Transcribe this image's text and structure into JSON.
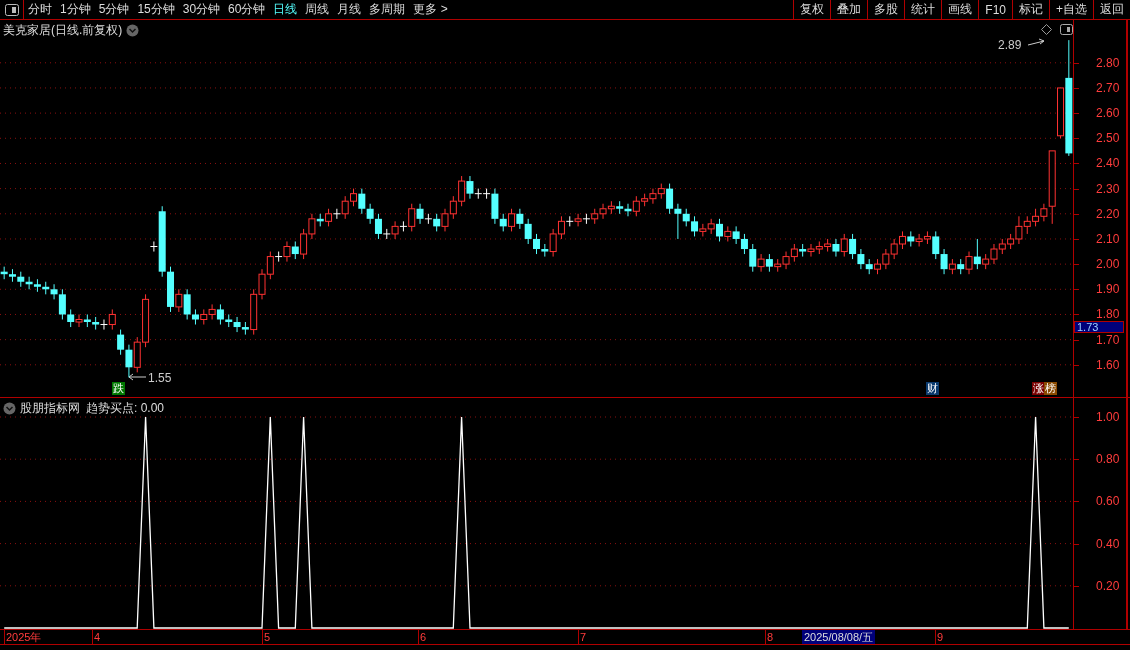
{
  "toolbar": {
    "periods": [
      {
        "label": "分时",
        "selected": false
      },
      {
        "label": "1分钟",
        "selected": false
      },
      {
        "label": "5分钟",
        "selected": false
      },
      {
        "label": "15分钟",
        "selected": false
      },
      {
        "label": "30分钟",
        "selected": false
      },
      {
        "label": "60分钟",
        "selected": false
      },
      {
        "label": "日线",
        "selected": true
      },
      {
        "label": "周线",
        "selected": false
      },
      {
        "label": "月线",
        "selected": false
      },
      {
        "label": "多周期",
        "selected": false
      },
      {
        "label": "更多 >",
        "selected": false
      }
    ],
    "buttons": [
      "复权",
      "叠加",
      "多股",
      "统计",
      "画线",
      "F10",
      "标记",
      "+自选",
      "返回"
    ]
  },
  "main_chart": {
    "title": "美克家居(日线.前复权)",
    "high_label": "2.89",
    "low_label": "1.55",
    "current_price": "1.73",
    "markers": [
      {
        "text": "跌",
        "color": "#007800"
      },
      {
        "text": "财",
        "color": "#0a3a6e"
      },
      {
        "text": "涨",
        "color": "#7a0000"
      },
      {
        "text": "榜",
        "color": "#8a4a00"
      }
    ],
    "chart_data": {
      "type": "candlestick",
      "grid": true,
      "ylim": [
        1.48,
        2.97
      ],
      "categories": [
        null,
        null,
        null,
        null,
        null,
        null,
        null,
        null,
        null,
        null,
        null,
        null,
        null,
        null,
        null,
        null,
        null,
        null,
        null,
        null,
        null,
        null,
        null,
        null,
        null,
        null,
        null,
        null,
        null,
        null,
        null,
        null,
        null,
        null,
        null,
        null,
        null,
        null,
        null,
        null,
        null,
        null,
        null,
        null,
        null,
        null,
        null,
        null,
        null,
        null,
        null,
        null,
        null,
        null,
        null,
        null,
        null,
        null,
        null,
        null,
        null,
        null,
        null,
        null,
        null,
        null,
        null,
        null,
        null,
        null,
        null,
        null,
        null,
        null,
        null,
        null,
        null,
        null,
        null,
        null,
        null,
        null,
        null,
        null,
        null,
        null,
        null,
        null,
        null,
        null,
        null,
        null,
        null,
        null,
        null,
        null,
        null,
        null,
        null,
        null,
        null,
        null,
        null,
        null,
        null,
        null,
        null,
        null,
        null,
        null,
        null,
        null,
        null,
        null,
        null,
        null,
        null,
        null,
        null,
        null,
        null,
        null,
        null,
        null,
        null,
        null,
        null,
        null,
        null
      ],
      "yticks": [
        {
          "value": 2.8,
          "label": "2.80"
        },
        {
          "value": 2.7,
          "label": "2.70"
        },
        {
          "value": 2.6,
          "label": "2.60"
        },
        {
          "value": 2.5,
          "label": "2.50"
        },
        {
          "value": 2.4,
          "label": "2.40"
        },
        {
          "value": 2.3,
          "label": "2.30"
        },
        {
          "value": 2.2,
          "label": "2.20"
        },
        {
          "value": 2.1,
          "label": "2.10"
        },
        {
          "value": 2.0,
          "label": "2.00"
        },
        {
          "value": 1.9,
          "label": "1.90"
        },
        {
          "value": 1.8,
          "label": "1.80"
        },
        {
          "value": 1.7,
          "label": "1.70"
        },
        {
          "value": 1.6,
          "label": "1.60"
        }
      ],
      "ohlc": [
        [
          1.97,
          1.99,
          1.94,
          1.96
        ],
        [
          1.96,
          1.98,
          1.93,
          1.95
        ],
        [
          1.95,
          1.97,
          1.91,
          1.93
        ],
        [
          1.93,
          1.95,
          1.9,
          1.92
        ],
        [
          1.92,
          1.94,
          1.89,
          1.91
        ],
        [
          1.91,
          1.93,
          1.88,
          1.9
        ],
        [
          1.9,
          1.92,
          1.86,
          1.88
        ],
        [
          1.88,
          1.9,
          1.78,
          1.8
        ],
        [
          1.8,
          1.82,
          1.75,
          1.77
        ],
        [
          1.77,
          1.8,
          1.75,
          1.78
        ],
        [
          1.78,
          1.8,
          1.75,
          1.77
        ],
        [
          1.77,
          1.79,
          1.74,
          1.76
        ],
        [
          1.76,
          1.78,
          1.74,
          1.76
        ],
        [
          1.76,
          1.82,
          1.74,
          1.8
        ],
        [
          1.72,
          1.74,
          1.64,
          1.66
        ],
        [
          1.66,
          1.68,
          1.55,
          1.59
        ],
        [
          1.59,
          1.71,
          1.57,
          1.69
        ],
        [
          1.69,
          1.88,
          1.67,
          1.86
        ],
        [
          2.07,
          2.09,
          2.05,
          2.07
        ],
        [
          2.21,
          2.23,
          1.95,
          1.97
        ],
        [
          1.97,
          1.99,
          1.81,
          1.83
        ],
        [
          1.83,
          1.9,
          1.81,
          1.88
        ],
        [
          1.88,
          1.9,
          1.78,
          1.8
        ],
        [
          1.8,
          1.82,
          1.76,
          1.78
        ],
        [
          1.78,
          1.82,
          1.76,
          1.8
        ],
        [
          1.8,
          1.84,
          1.78,
          1.82
        ],
        [
          1.82,
          1.84,
          1.76,
          1.78
        ],
        [
          1.78,
          1.8,
          1.75,
          1.77
        ],
        [
          1.77,
          1.79,
          1.73,
          1.75
        ],
        [
          1.75,
          1.77,
          1.72,
          1.74
        ],
        [
          1.74,
          1.9,
          1.72,
          1.88
        ],
        [
          1.88,
          1.98,
          1.86,
          1.96
        ],
        [
          1.96,
          2.05,
          1.94,
          2.03
        ],
        [
          2.03,
          2.05,
          2.01,
          2.03
        ],
        [
          2.03,
          2.09,
          2.01,
          2.07
        ],
        [
          2.07,
          2.09,
          2.02,
          2.04
        ],
        [
          2.04,
          2.14,
          2.02,
          2.12
        ],
        [
          2.12,
          2.2,
          2.1,
          2.18
        ],
        [
          2.18,
          2.2,
          2.15,
          2.17
        ],
        [
          2.17,
          2.22,
          2.15,
          2.2
        ],
        [
          2.2,
          2.22,
          2.18,
          2.2
        ],
        [
          2.2,
          2.27,
          2.18,
          2.25
        ],
        [
          2.25,
          2.3,
          2.23,
          2.28
        ],
        [
          2.28,
          2.3,
          2.2,
          2.22
        ],
        [
          2.22,
          2.24,
          2.16,
          2.18
        ],
        [
          2.18,
          2.2,
          2.1,
          2.12
        ],
        [
          2.12,
          2.14,
          2.1,
          2.12
        ],
        [
          2.12,
          2.17,
          2.1,
          2.15
        ],
        [
          2.15,
          2.17,
          2.13,
          2.15
        ],
        [
          2.15,
          2.24,
          2.13,
          2.22
        ],
        [
          2.22,
          2.24,
          2.16,
          2.18
        ],
        [
          2.18,
          2.2,
          2.16,
          2.18
        ],
        [
          2.18,
          2.2,
          2.13,
          2.15
        ],
        [
          2.15,
          2.22,
          2.13,
          2.2
        ],
        [
          2.2,
          2.27,
          2.18,
          2.25
        ],
        [
          2.25,
          2.35,
          2.23,
          2.33
        ],
        [
          2.33,
          2.35,
          2.26,
          2.28
        ],
        [
          2.28,
          2.3,
          2.26,
          2.28
        ],
        [
          2.28,
          2.3,
          2.26,
          2.28
        ],
        [
          2.28,
          2.3,
          2.16,
          2.18
        ],
        [
          2.18,
          2.2,
          2.13,
          2.15
        ],
        [
          2.15,
          2.22,
          2.13,
          2.2
        ],
        [
          2.2,
          2.22,
          2.14,
          2.16
        ],
        [
          2.16,
          2.18,
          2.08,
          2.1
        ],
        [
          2.1,
          2.12,
          2.04,
          2.06
        ],
        [
          2.06,
          2.08,
          2.03,
          2.05
        ],
        [
          2.05,
          2.14,
          2.03,
          2.12
        ],
        [
          2.12,
          2.19,
          2.1,
          2.17
        ],
        [
          2.17,
          2.19,
          2.15,
          2.17
        ],
        [
          2.17,
          2.2,
          2.15,
          2.18
        ],
        [
          2.18,
          2.2,
          2.16,
          2.18
        ],
        [
          2.18,
          2.22,
          2.16,
          2.2
        ],
        [
          2.2,
          2.24,
          2.18,
          2.22
        ],
        [
          2.22,
          2.25,
          2.2,
          2.23
        ],
        [
          2.23,
          2.25,
          2.2,
          2.22
        ],
        [
          2.22,
          2.24,
          2.19,
          2.21
        ],
        [
          2.21,
          2.27,
          2.19,
          2.25
        ],
        [
          2.25,
          2.28,
          2.23,
          2.26
        ],
        [
          2.26,
          2.3,
          2.24,
          2.28
        ],
        [
          2.28,
          2.32,
          2.26,
          2.3
        ],
        [
          2.3,
          2.32,
          2.2,
          2.22
        ],
        [
          2.22,
          2.24,
          2.1,
          2.2
        ],
        [
          2.2,
          2.22,
          2.15,
          2.17
        ],
        [
          2.17,
          2.19,
          2.11,
          2.13
        ],
        [
          2.13,
          2.16,
          2.11,
          2.14
        ],
        [
          2.14,
          2.18,
          2.12,
          2.16
        ],
        [
          2.16,
          2.18,
          2.09,
          2.11
        ],
        [
          2.11,
          2.15,
          2.09,
          2.13
        ],
        [
          2.13,
          2.15,
          2.08,
          2.1
        ],
        [
          2.1,
          2.12,
          2.04,
          2.06
        ],
        [
          2.06,
          2.08,
          1.97,
          1.99
        ],
        [
          1.99,
          2.04,
          1.97,
          2.02
        ],
        [
          2.02,
          2.04,
          1.97,
          1.99
        ],
        [
          1.99,
          2.02,
          1.97,
          2.0
        ],
        [
          2.0,
          2.05,
          1.98,
          2.03
        ],
        [
          2.03,
          2.08,
          2.01,
          2.06
        ],
        [
          2.06,
          2.08,
          2.03,
          2.05
        ],
        [
          2.05,
          2.08,
          2.03,
          2.06
        ],
        [
          2.06,
          2.09,
          2.04,
          2.07
        ],
        [
          2.07,
          2.1,
          2.05,
          2.08
        ],
        [
          2.08,
          2.1,
          2.03,
          2.05
        ],
        [
          2.05,
          2.12,
          2.03,
          2.1
        ],
        [
          2.1,
          2.12,
          2.02,
          2.04
        ],
        [
          2.04,
          2.06,
          1.98,
          2.0
        ],
        [
          2.0,
          2.02,
          1.96,
          1.98
        ],
        [
          1.98,
          2.02,
          1.96,
          2.0
        ],
        [
          2.0,
          2.06,
          1.98,
          2.04
        ],
        [
          2.04,
          2.1,
          2.02,
          2.08
        ],
        [
          2.08,
          2.13,
          2.06,
          2.11
        ],
        [
          2.11,
          2.13,
          2.07,
          2.09
        ],
        [
          2.09,
          2.12,
          2.07,
          2.1
        ],
        [
          2.1,
          2.13,
          2.08,
          2.11
        ],
        [
          2.11,
          2.13,
          2.02,
          2.04
        ],
        [
          2.04,
          2.06,
          1.96,
          1.98
        ],
        [
          1.98,
          2.02,
          1.96,
          2.0
        ],
        [
          2.0,
          2.02,
          1.96,
          1.98
        ],
        [
          1.98,
          2.05,
          1.96,
          2.03
        ],
        [
          2.03,
          2.1,
          1.98,
          2.0
        ],
        [
          2.0,
          2.04,
          1.98,
          2.02
        ],
        [
          2.02,
          2.08,
          2.0,
          2.06
        ],
        [
          2.06,
          2.1,
          2.04,
          2.08
        ],
        [
          2.08,
          2.12,
          2.06,
          2.1
        ],
        [
          2.1,
          2.19,
          2.08,
          2.15
        ],
        [
          2.15,
          2.19,
          2.12,
          2.17
        ],
        [
          2.17,
          2.22,
          2.15,
          2.19
        ],
        [
          2.19,
          2.24,
          2.17,
          2.22
        ],
        [
          2.23,
          2.45,
          2.16,
          2.45
        ],
        [
          2.51,
          2.7,
          2.5,
          2.7
        ],
        [
          2.74,
          2.89,
          2.43,
          2.44
        ]
      ]
    }
  },
  "indicator": {
    "name": "股朋指标网",
    "value_text": ": 0.00",
    "chart_data": {
      "type": "line",
      "grid": true,
      "ylim": [
        0,
        1
      ],
      "yticks": [
        {
          "value": 0.2,
          "label": "0.20"
        },
        {
          "value": 0.4,
          "label": "0.40"
        },
        {
          "value": 0.6,
          "label": "0.60"
        },
        {
          "value": 0.8,
          "label": "0.80"
        },
        {
          "value": 1.0,
          "label": "1.00"
        }
      ],
      "series": [
        {
          "name": "趋势买点",
          "color": "#ffffff",
          "values": [
            0,
            0,
            0,
            0,
            0,
            0,
            0,
            0,
            0,
            0,
            0,
            0,
            0,
            0,
            0,
            0,
            0,
            1,
            0,
            0,
            0,
            0,
            0,
            0,
            0,
            0,
            0,
            0,
            0,
            0,
            0,
            0,
            1,
            0,
            0,
            0,
            1,
            0,
            0,
            0,
            0,
            0,
            0,
            0,
            0,
            0,
            0,
            0,
            0,
            0,
            0,
            0,
            0,
            0,
            0,
            1,
            0,
            0,
            0,
            0,
            0,
            0,
            0,
            0,
            0,
            0,
            0,
            0,
            0,
            0,
            0,
            0,
            0,
            0,
            0,
            0,
            0,
            0,
            0,
            0,
            0,
            0,
            0,
            0,
            0,
            0,
            0,
            0,
            0,
            0,
            0,
            0,
            0,
            0,
            0,
            0,
            0,
            0,
            0,
            0,
            0,
            0,
            0,
            0,
            0,
            0,
            0,
            0,
            0,
            0,
            0,
            0,
            0,
            0,
            0,
            0,
            0,
            0,
            0,
            0,
            0,
            0,
            0,
            0,
            1,
            0,
            0,
            0,
            0
          ]
        }
      ]
    }
  },
  "date_axis": {
    "labels": [
      "2025年",
      "4",
      "5",
      "6",
      "7",
      "8",
      "9"
    ],
    "cursor_date": "2025/08/08/五"
  }
}
